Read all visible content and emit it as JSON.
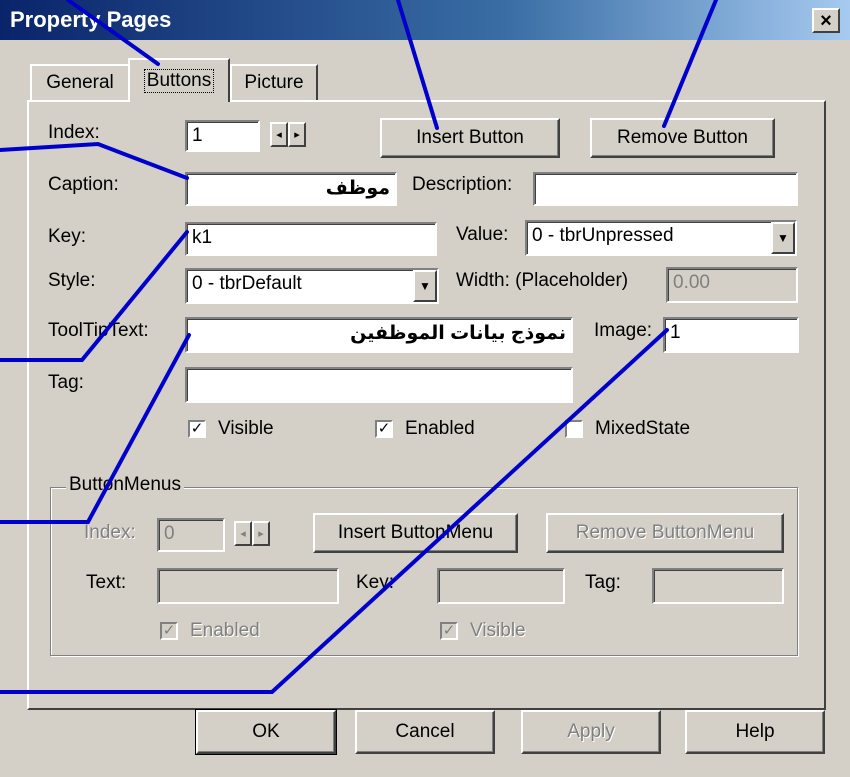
{
  "window": {
    "title": "Property Pages",
    "close_label": "×"
  },
  "tabs": [
    {
      "label": "General",
      "active": false
    },
    {
      "label": "Buttons",
      "active": true
    },
    {
      "label": "Picture",
      "active": false
    }
  ],
  "buttons_page": {
    "index_label": "Index:",
    "index_value": "1",
    "insert_button": "Insert Button",
    "remove_button": "Remove Button",
    "caption_label": "Caption:",
    "caption_value": "موظف",
    "description_label": "Description:",
    "description_value": "",
    "key_label": "Key:",
    "key_value": "k1",
    "value_label": "Value:",
    "value_selected": "0 - tbrUnpressed",
    "style_label": "Style:",
    "style_selected": "0 - tbrDefault",
    "width_label": "Width: (Placeholder)",
    "width_value": "0.00",
    "tooltip_label": "ToolTipText:",
    "tooltip_value": "نموذج بيانات الموظفين",
    "image_label": "Image:",
    "image_value": "1",
    "tag_label": "Tag:",
    "tag_value": "",
    "visible_label": "Visible",
    "visible_checked": true,
    "enabled_label": "Enabled",
    "enabled_checked": true,
    "mixedstate_label": "MixedState",
    "mixedstate_checked": false
  },
  "button_menus": {
    "group_title": "ButtonMenus",
    "index_label": "Index:",
    "index_value": "0",
    "insert_label": "Insert ButtonMenu",
    "remove_label": "Remove ButtonMenu",
    "text_label": "Text:",
    "text_value": "",
    "key_label": "Key:",
    "key_value": "",
    "tag_label": "Tag:",
    "tag_value": "",
    "enabled_label": "Enabled",
    "visible_label": "Visible"
  },
  "footer": {
    "ok": "OK",
    "cancel": "Cancel",
    "apply": "Apply",
    "help": "Help"
  },
  "check_glyph": "✓",
  "spin_left": "◂",
  "spin_right": "▸",
  "dropdown_glyph": "▼",
  "annotation_color": "#0000cc"
}
